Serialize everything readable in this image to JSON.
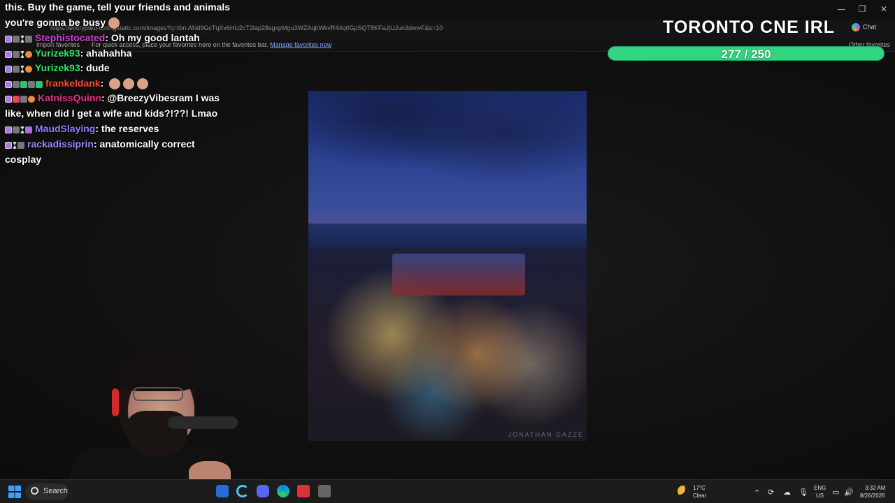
{
  "browser": {
    "url": "https://encrypted-tbn0.gstatic.com/images?q=tbn:ANd9GcTqXv6HU2cT2lap28sgxpMgu3WZAqbWkvR44q0GpSQT8KFaJjUJun3dwwF&s=10",
    "favorites_bar": {
      "import_label": "Import favorites",
      "hint": "For quick access, place your favorites here on the favorites bar.",
      "manage_link": "Manage favorites now",
      "other_favorites": "Other favorites"
    },
    "chat_button": "Chat"
  },
  "overlay": {
    "stream_title": "TORONTO CNE IRL",
    "goal": {
      "current": 277,
      "target": 250,
      "text": "277 / 250",
      "progress": 1.0
    }
  },
  "chat": {
    "messages": [
      {
        "user": "",
        "user_color": "#ffffff",
        "text": "this. Buy the game, tell your friends and animals"
      },
      {
        "user": "",
        "user_color": "#ffffff",
        "text": "you're gonna be busy"
      },
      {
        "user": "Stephistocated",
        "user_color": "#d43fd6",
        "text": "Oh my good lantah"
      },
      {
        "user": "Yurizek93",
        "user_color": "#2ee66a",
        "text": "ahahahha"
      },
      {
        "user": "Yurizek93",
        "user_color": "#2ee66a",
        "text": "dude"
      },
      {
        "user": "frankeldank",
        "user_color": "#ff4a2e",
        "text": ""
      },
      {
        "user": "KatnissQuinn",
        "user_color": "#e0358a",
        "text": "@BreezyVibesram I was like, when did I get a wife and kids?!??! Lmao"
      },
      {
        "user": "MaudSlaying",
        "user_color": "#8f7bff",
        "text": "the reserves"
      },
      {
        "user": "rackadissiprin",
        "user_color": "#9b8cff",
        "text": "anatomically correct cosplay"
      }
    ]
  },
  "image": {
    "watermark": "JONATHAN GAZZE"
  },
  "taskbar": {
    "search_label": "Search",
    "weather_temp": "17°C",
    "weather_desc": "Clear",
    "lang_top": "ENG",
    "lang_bottom": "US",
    "time": "3:32 AM",
    "date": "8/26/2026"
  }
}
